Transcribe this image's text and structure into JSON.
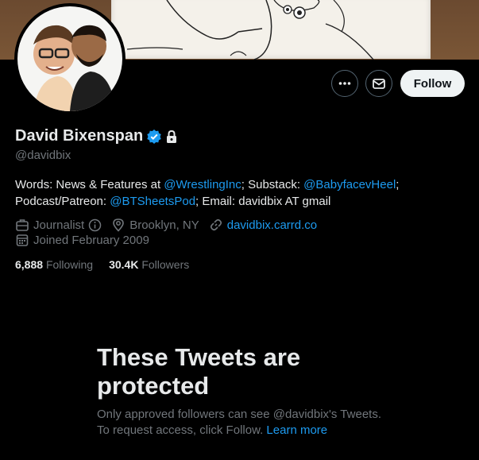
{
  "profile": {
    "name": "David Bixenspan",
    "handle": "@davidbix",
    "bio_line1_prefix": "Words: News & Features at ",
    "bio_link1": "@WrestlingInc",
    "bio_line1_mid": "; Substack: ",
    "bio_link2": "@BabyfacevHeel",
    "bio_line1_suffix": ";",
    "bio_line2_prefix": "Podcast/Patreon: ",
    "bio_link3": "@BTSheetsPod",
    "bio_line2_suffix": "; Email: davidbix AT gmail",
    "category": "Journalist",
    "location": "Brooklyn, NY",
    "website": "davidbix.carrd.co",
    "joined": "Joined February 2009",
    "following_count": "6,888",
    "following_label": "Following",
    "followers_count": "30.4K",
    "followers_label": "Followers"
  },
  "actions": {
    "follow_label": "Follow",
    "more_icon": "more-icon",
    "message_icon": "envelope-icon"
  },
  "protected": {
    "title": "These Tweets are protected",
    "text_prefix": "Only approved followers can see @davidbix's Tweets. To request access, click Follow. ",
    "learn_more": "Learn more"
  },
  "colors": {
    "background": "#000000",
    "text": "#e7e9ea",
    "secondary": "#71767b",
    "link": "#1d9bf0",
    "follow_bg": "#eff3f4"
  }
}
